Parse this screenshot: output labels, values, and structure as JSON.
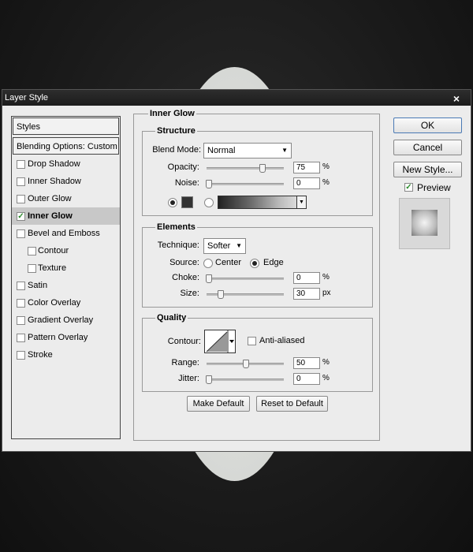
{
  "window": {
    "title": "Layer Style",
    "close": "×"
  },
  "sidebar": {
    "header": "Styles",
    "blending": "Blending Options: Custom",
    "items": [
      {
        "label": "Drop Shadow",
        "checked": false
      },
      {
        "label": "Inner Shadow",
        "checked": false
      },
      {
        "label": "Outer Glow",
        "checked": false
      },
      {
        "label": "Inner Glow",
        "checked": true
      },
      {
        "label": "Bevel and Emboss",
        "checked": false
      },
      {
        "label": "Contour",
        "checked": false
      },
      {
        "label": "Texture",
        "checked": false
      },
      {
        "label": "Satin",
        "checked": false
      },
      {
        "label": "Color Overlay",
        "checked": false
      },
      {
        "label": "Gradient Overlay",
        "checked": false
      },
      {
        "label": "Pattern Overlay",
        "checked": false
      },
      {
        "label": "Stroke",
        "checked": false
      }
    ],
    "check_glyph": "✓"
  },
  "panel": {
    "title": "Inner Glow",
    "structure": {
      "title": "Structure",
      "blend_mode_label": "Blend Mode:",
      "blend_mode_value": "Normal",
      "opacity_label": "Opacity:",
      "opacity_value": "75",
      "noise_label": "Noise:",
      "noise_value": "0",
      "unit": "%",
      "opacity_percent": 75,
      "noise_percent": 0
    },
    "elements": {
      "title": "Elements",
      "technique_label": "Technique:",
      "technique_value": "Softer",
      "source_label": "Source:",
      "source_center": "Center",
      "source_edge": "Edge",
      "choke_label": "Choke:",
      "choke_value": "0",
      "choke_unit": "%",
      "size_label": "Size:",
      "size_value": "30",
      "size_unit": "px"
    },
    "quality": {
      "title": "Quality",
      "contour_label": "Contour:",
      "anti_aliased": "Anti-aliased",
      "range_label": "Range:",
      "range_value": "50",
      "jitter_label": "Jitter:",
      "jitter_value": "0",
      "unit": "%"
    },
    "make_default": "Make Default",
    "reset_default": "Reset to Default"
  },
  "actions": {
    "ok": "OK",
    "cancel": "Cancel",
    "new_style": "New Style...",
    "preview": "Preview",
    "preview_checked": true
  },
  "colors": {
    "glow_swatch": "#333333",
    "check": "#2a8a2a"
  }
}
